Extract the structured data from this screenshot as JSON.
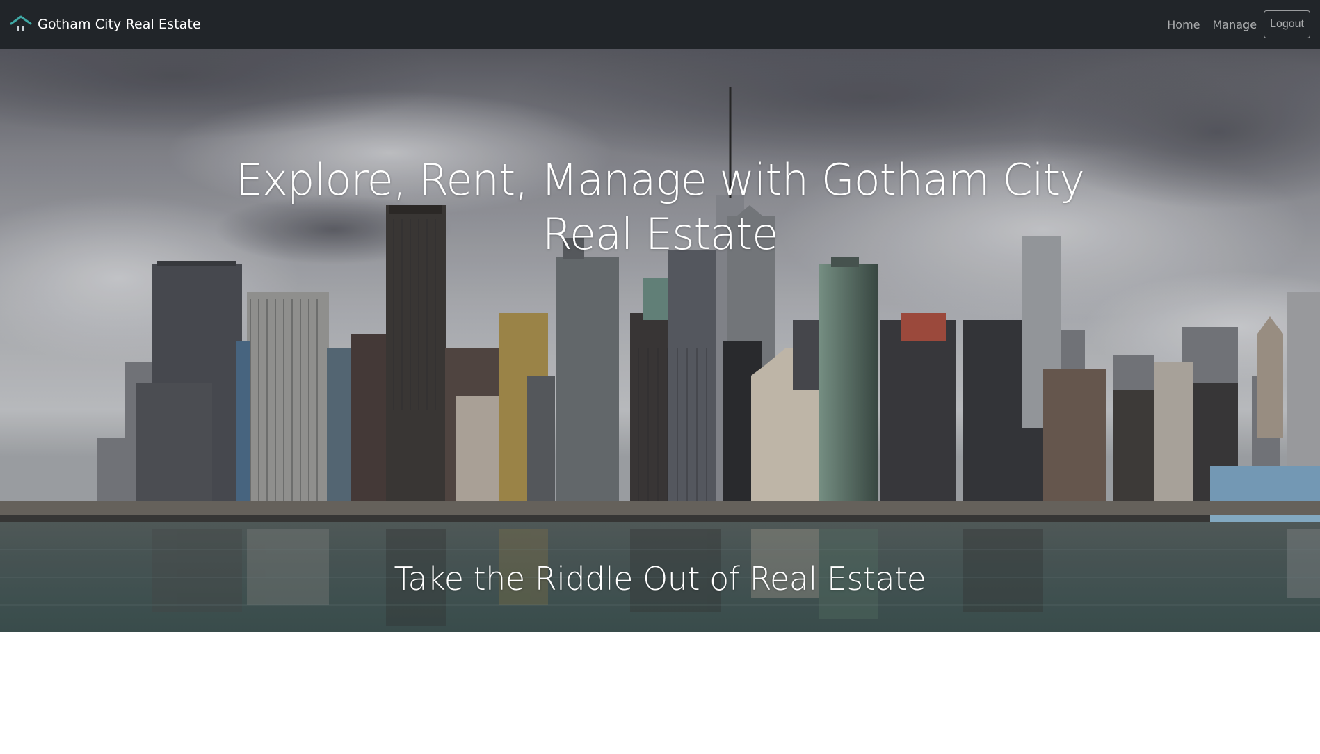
{
  "navbar": {
    "brand_text": "Gotham City Real Estate",
    "brand_icon": "house-icon",
    "links": [
      {
        "label": "Home"
      },
      {
        "label": "Manage"
      }
    ],
    "logout_label": "Logout"
  },
  "hero": {
    "title": "Explore, Rent, Manage with Gotham City Real Estate",
    "subtitle": "Take the Riddle Out of Real Estate",
    "background": "city-skyline-image"
  },
  "colors": {
    "navbar_bg": "#212529",
    "brand_icon_roof": "#3fa9a5",
    "text": "#ffffff"
  }
}
